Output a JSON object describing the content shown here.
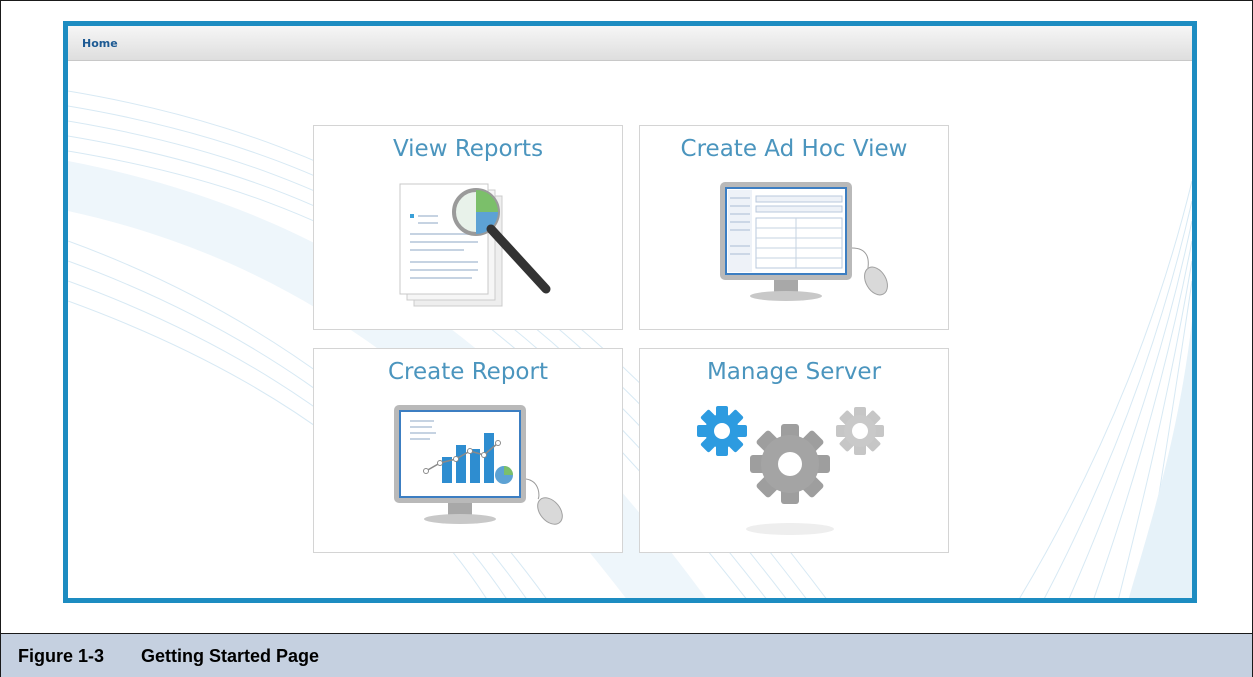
{
  "breadcrumb": {
    "home_label": "Home"
  },
  "tiles": [
    {
      "title": "View Reports",
      "icon": "magnifier-report-icon"
    },
    {
      "title": "Create Ad Hoc View",
      "icon": "monitor-table-icon"
    },
    {
      "title": "Create Report",
      "icon": "monitor-chart-icon"
    },
    {
      "title": "Manage Server",
      "icon": "gears-icon"
    }
  ],
  "caption": {
    "number": "Figure 1-3",
    "text": "Getting Started Page"
  },
  "colors": {
    "accent": "#1d8cc1",
    "tile_title": "#4b95be",
    "caption_bg": "#c5d0e0",
    "home_link": "#1d5a93"
  }
}
